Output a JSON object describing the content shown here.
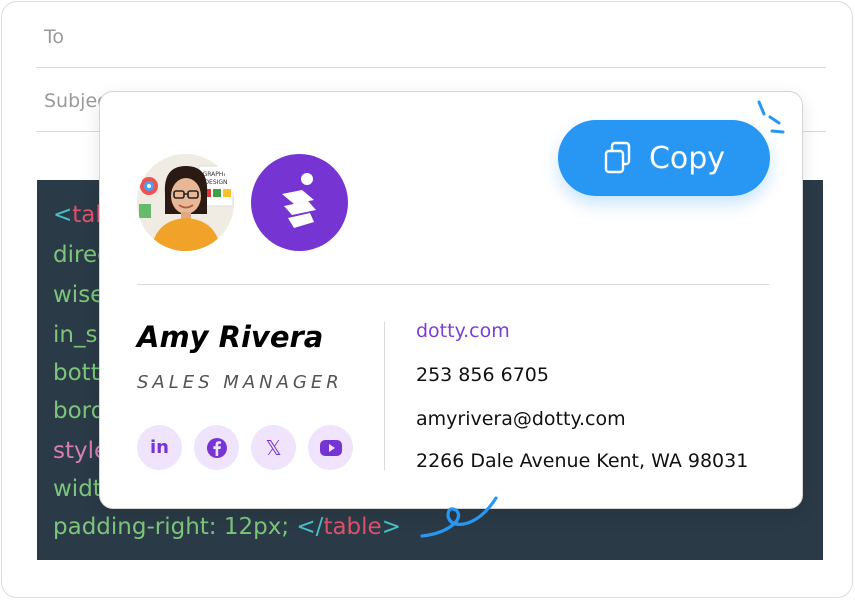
{
  "compose": {
    "to_label": "To",
    "subject_label": "Subject"
  },
  "code": {
    "lines": [
      {
        "open": "<",
        "tag": "table"
      },
      {
        "text": "direction: ltr;"
      },
      {
        "text": "wisework"
      },
      {
        "text": "in_sig"
      },
      {
        "text": "bottom"
      },
      {
        "text": "border"
      },
      {
        "text": "style"
      },
      {
        "text": "width"
      },
      {
        "text": "padding-right: 12px; ",
        "close_open": "</",
        "close_tag": "table",
        "close_end": ">"
      }
    ]
  },
  "signature": {
    "name": "Amy Rivera",
    "title": "SALES MANAGER",
    "website": "dotty.com",
    "phone": "253 856 6705",
    "email": "amyrivera@dotty.com",
    "address": "2266 Dale Avenue Kent, WA 98031",
    "socials": [
      {
        "name": "linkedin",
        "glyph": "in"
      },
      {
        "name": "facebook"
      },
      {
        "name": "x",
        "glyph": "𝕏"
      },
      {
        "name": "youtube"
      }
    ]
  },
  "copy_button": {
    "label": "Copy"
  },
  "avatar_poster_text": "GRAPHIC DESIGN",
  "colors": {
    "accent_purple": "#7634d3",
    "copy_blue": "#2797f3",
    "code_bg": "#2a3a46",
    "code_green": "#7cc57a",
    "code_pink": "#d77fb4",
    "code_red": "#e0506a",
    "code_teal": "#48c0c7"
  }
}
